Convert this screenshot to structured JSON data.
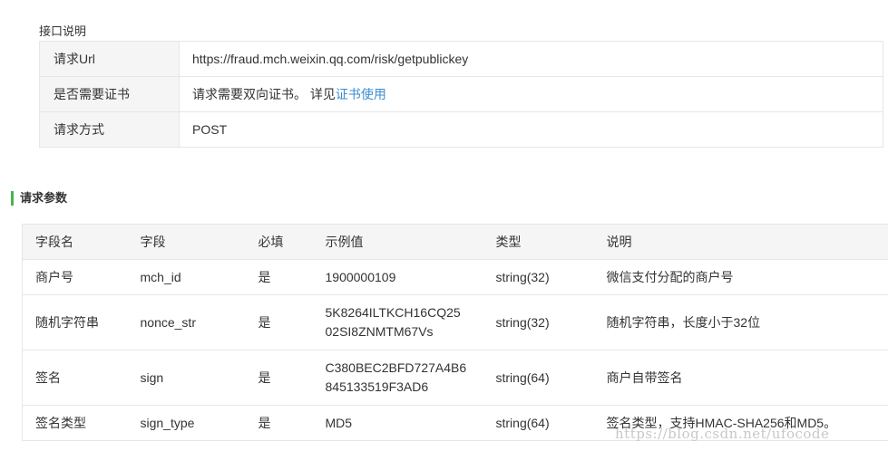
{
  "api_section": {
    "title": "接口说明",
    "rows": [
      {
        "key": "请求Url",
        "value": "https://fraud.mch.weixin.qq.com/risk/getpublickey"
      },
      {
        "key": "是否需要证书",
        "value": "请求需要双向证书。 详见",
        "link": "证书使用"
      },
      {
        "key": "请求方式",
        "value": "POST"
      }
    ]
  },
  "params_section": {
    "title": "请求参数",
    "accent_color": "#44b549",
    "headers": [
      "字段名",
      "字段",
      "必填",
      "示例值",
      "类型",
      "说明"
    ],
    "rows": [
      {
        "name": "商户号",
        "field": "mch_id",
        "required": "是",
        "example_1": "1900000109",
        "example_2": "",
        "type": "string(32)",
        "desc": "微信支付分配的商户号"
      },
      {
        "name": "随机字符串",
        "field": "nonce_str",
        "required": "是",
        "example_1": "5K8264ILTKCH16CQ25",
        "example_2": "02SI8ZNMTM67Vs",
        "type": "string(32)",
        "desc": "随机字符串，长度小于32位"
      },
      {
        "name": "签名",
        "field": "sign",
        "required": "是",
        "example_1": "C380BEC2BFD727A4B6",
        "example_2": "845133519F3AD6",
        "type": "string(64)",
        "desc": "商户自带签名"
      },
      {
        "name": "签名类型",
        "field": "sign_type",
        "required": "是",
        "example_1": "MD5",
        "example_2": "",
        "type": "string(64)",
        "desc": "签名类型，支持HMAC-SHA256和MD5。"
      }
    ]
  },
  "watermark": "https://blog.csdn.net/ufocode"
}
